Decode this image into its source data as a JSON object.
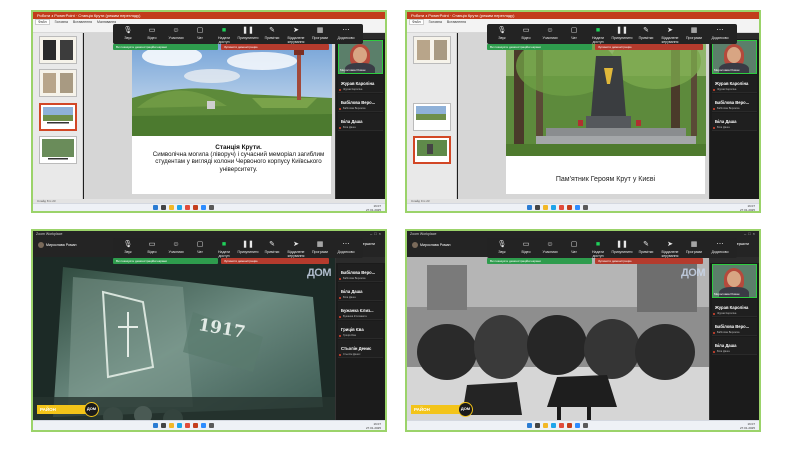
{
  "ppt": {
    "title_text": "Роботи з PowerPoint · Станція Крути (режим перегляду)",
    "tabs": [
      "Файл",
      "Головна",
      "Вставлення",
      "Малювання",
      "Конструктор",
      "Переходи",
      "Анімація",
      "Показ слайдів",
      "Рецензування",
      "Вигляд"
    ],
    "status_left": "Слайд 8 із 23",
    "status_right_1": "Слайд 9 із 23"
  },
  "zoom_toolbar": {
    "items": [
      {
        "icon": "mic-icon",
        "label": "Звук"
      },
      {
        "icon": "video-icon",
        "label": "Відео"
      },
      {
        "icon": "people-icon",
        "label": "Учасники"
      },
      {
        "icon": "chat-icon",
        "label": "Чат"
      },
      {
        "icon": "share-icon",
        "label": "Надати доступ"
      },
      {
        "icon": "pause-icon",
        "label": "Призупинити"
      },
      {
        "icon": "annotate-icon",
        "label": "Примітки"
      },
      {
        "icon": "remote-icon",
        "label": "Віддалене керування"
      },
      {
        "icon": "apps-icon",
        "label": "Програми"
      },
      {
        "icon": "more-icon",
        "label": "Додатково"
      }
    ],
    "banner_green": "Ви показуєте демонстраційні екрани",
    "banner_red": "Зупинити демонстрацію"
  },
  "slide1": {
    "title": "Станція Крути.",
    "body": "Символічна могила (ліворуч) і сучасний меморіал загиблим студентам у вигляді колони Червоного корпусу Київського університету."
  },
  "slide2": {
    "caption": "Пам'ятник Героям Крут у Києві"
  },
  "participants_top": [
    {
      "name": "Журав Кароліна",
      "small": "Журав Кароліна"
    },
    {
      "name": "Бабілова Веро...",
      "small": "Бабілова Вероніка"
    },
    {
      "name": "Біла Даша",
      "small": "Біла Даша"
    }
  ],
  "participants_q3": [
    {
      "name": "Бабілова Веро...",
      "small": "Бабілова Вероніка"
    },
    {
      "name": "Біла Даша",
      "small": "Біла Даша"
    },
    {
      "name": "Бужанка Єлиз...",
      "small": "Бужанка Єлизавета"
    },
    {
      "name": "Гриців Єва",
      "small": "Гриців Єва"
    },
    {
      "name": "Стьопін Денис",
      "small": "Стьопін Денис"
    }
  ],
  "participants_q4": [
    {
      "name": "Журав Кароліна",
      "small": "Журав Кароліна"
    },
    {
      "name": "Бабілова Веро...",
      "small": "Бабілова Вероніка"
    },
    {
      "name": "Біла Даша",
      "small": "Біла Даша"
    }
  ],
  "video_tile_caption": "Мирослава Роман",
  "zoom_window": {
    "app_title": "Zoom Workplace",
    "user": "Мирослава Роман",
    "end_label": "Завершити"
  },
  "video": {
    "logo": "ДОМ",
    "raion_text": "РАЙОН",
    "ring_text": "ДОМ",
    "flag_text": "1917"
  },
  "taskbar": {
    "time": "16:07",
    "date": "27.01.2025"
  }
}
